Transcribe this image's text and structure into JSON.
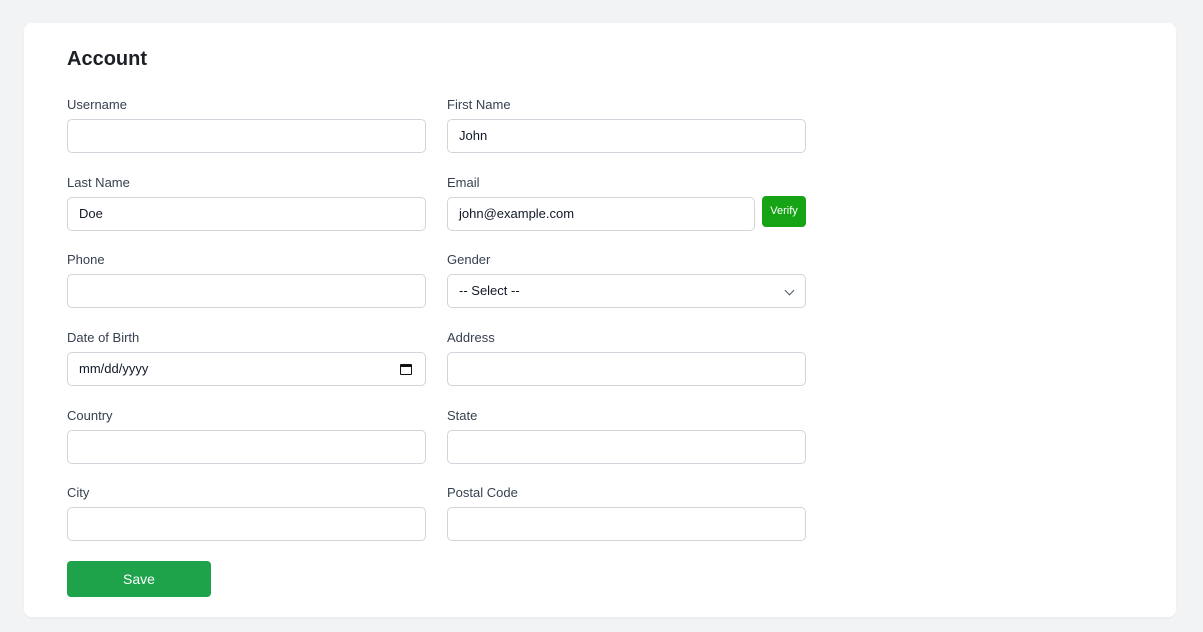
{
  "form": {
    "title": "Account",
    "fields": {
      "username": {
        "label": "Username",
        "value": ""
      },
      "first_name": {
        "label": "First Name",
        "value": "John"
      },
      "last_name": {
        "label": "Last Name",
        "value": "Doe"
      },
      "email": {
        "label": "Email",
        "value": "john@example.com",
        "verify_label": "Verify"
      },
      "phone": {
        "label": "Phone",
        "value": ""
      },
      "gender": {
        "label": "Gender",
        "selected": "-- Select --"
      },
      "dob": {
        "label": "Date of Birth",
        "value": "mm/dd/yyyy"
      },
      "address": {
        "label": "Address",
        "value": ""
      },
      "country": {
        "label": "Country",
        "value": ""
      },
      "state": {
        "label": "State",
        "value": ""
      },
      "city": {
        "label": "City",
        "value": ""
      },
      "postal_code": {
        "label": "Postal Code",
        "value": ""
      }
    },
    "save_label": "Save"
  },
  "colors": {
    "verify_button": "#16a316",
    "save_button": "#1ea34a",
    "background": "#f2f3f5"
  },
  "icons": {
    "gender_dropdown": "chevron-down-icon",
    "dob_picker": "calendar-icon"
  }
}
